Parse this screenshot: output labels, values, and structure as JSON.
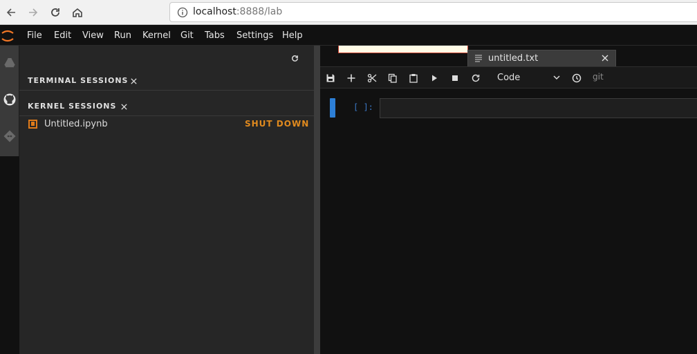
{
  "browser": {
    "url_host": "localhost",
    "url_rest": ":8888/lab"
  },
  "menu": {
    "items": [
      "File",
      "Edit",
      "View",
      "Run",
      "Kernel",
      "Git",
      "Tabs",
      "Settings",
      "Help"
    ]
  },
  "activity_bar": {
    "icons": [
      "google-drive-icon",
      "github-icon",
      "git-icon"
    ]
  },
  "sidebar": {
    "sections": [
      {
        "title": "TERMINAL SESSIONS"
      },
      {
        "title": "KERNEL SESSIONS"
      }
    ],
    "kernel_sessions": [
      {
        "name": "Untitled.ipynb",
        "action": "SHUT DOWN"
      }
    ]
  },
  "main": {
    "tab_label": "untitled.txt",
    "cell_type": "Code",
    "git_label": "git",
    "prompt": "[ ]:"
  },
  "colors": {
    "accent": "#e07b1a",
    "cell_marker": "#2d7fd6",
    "prompt": "#3b78c6"
  }
}
